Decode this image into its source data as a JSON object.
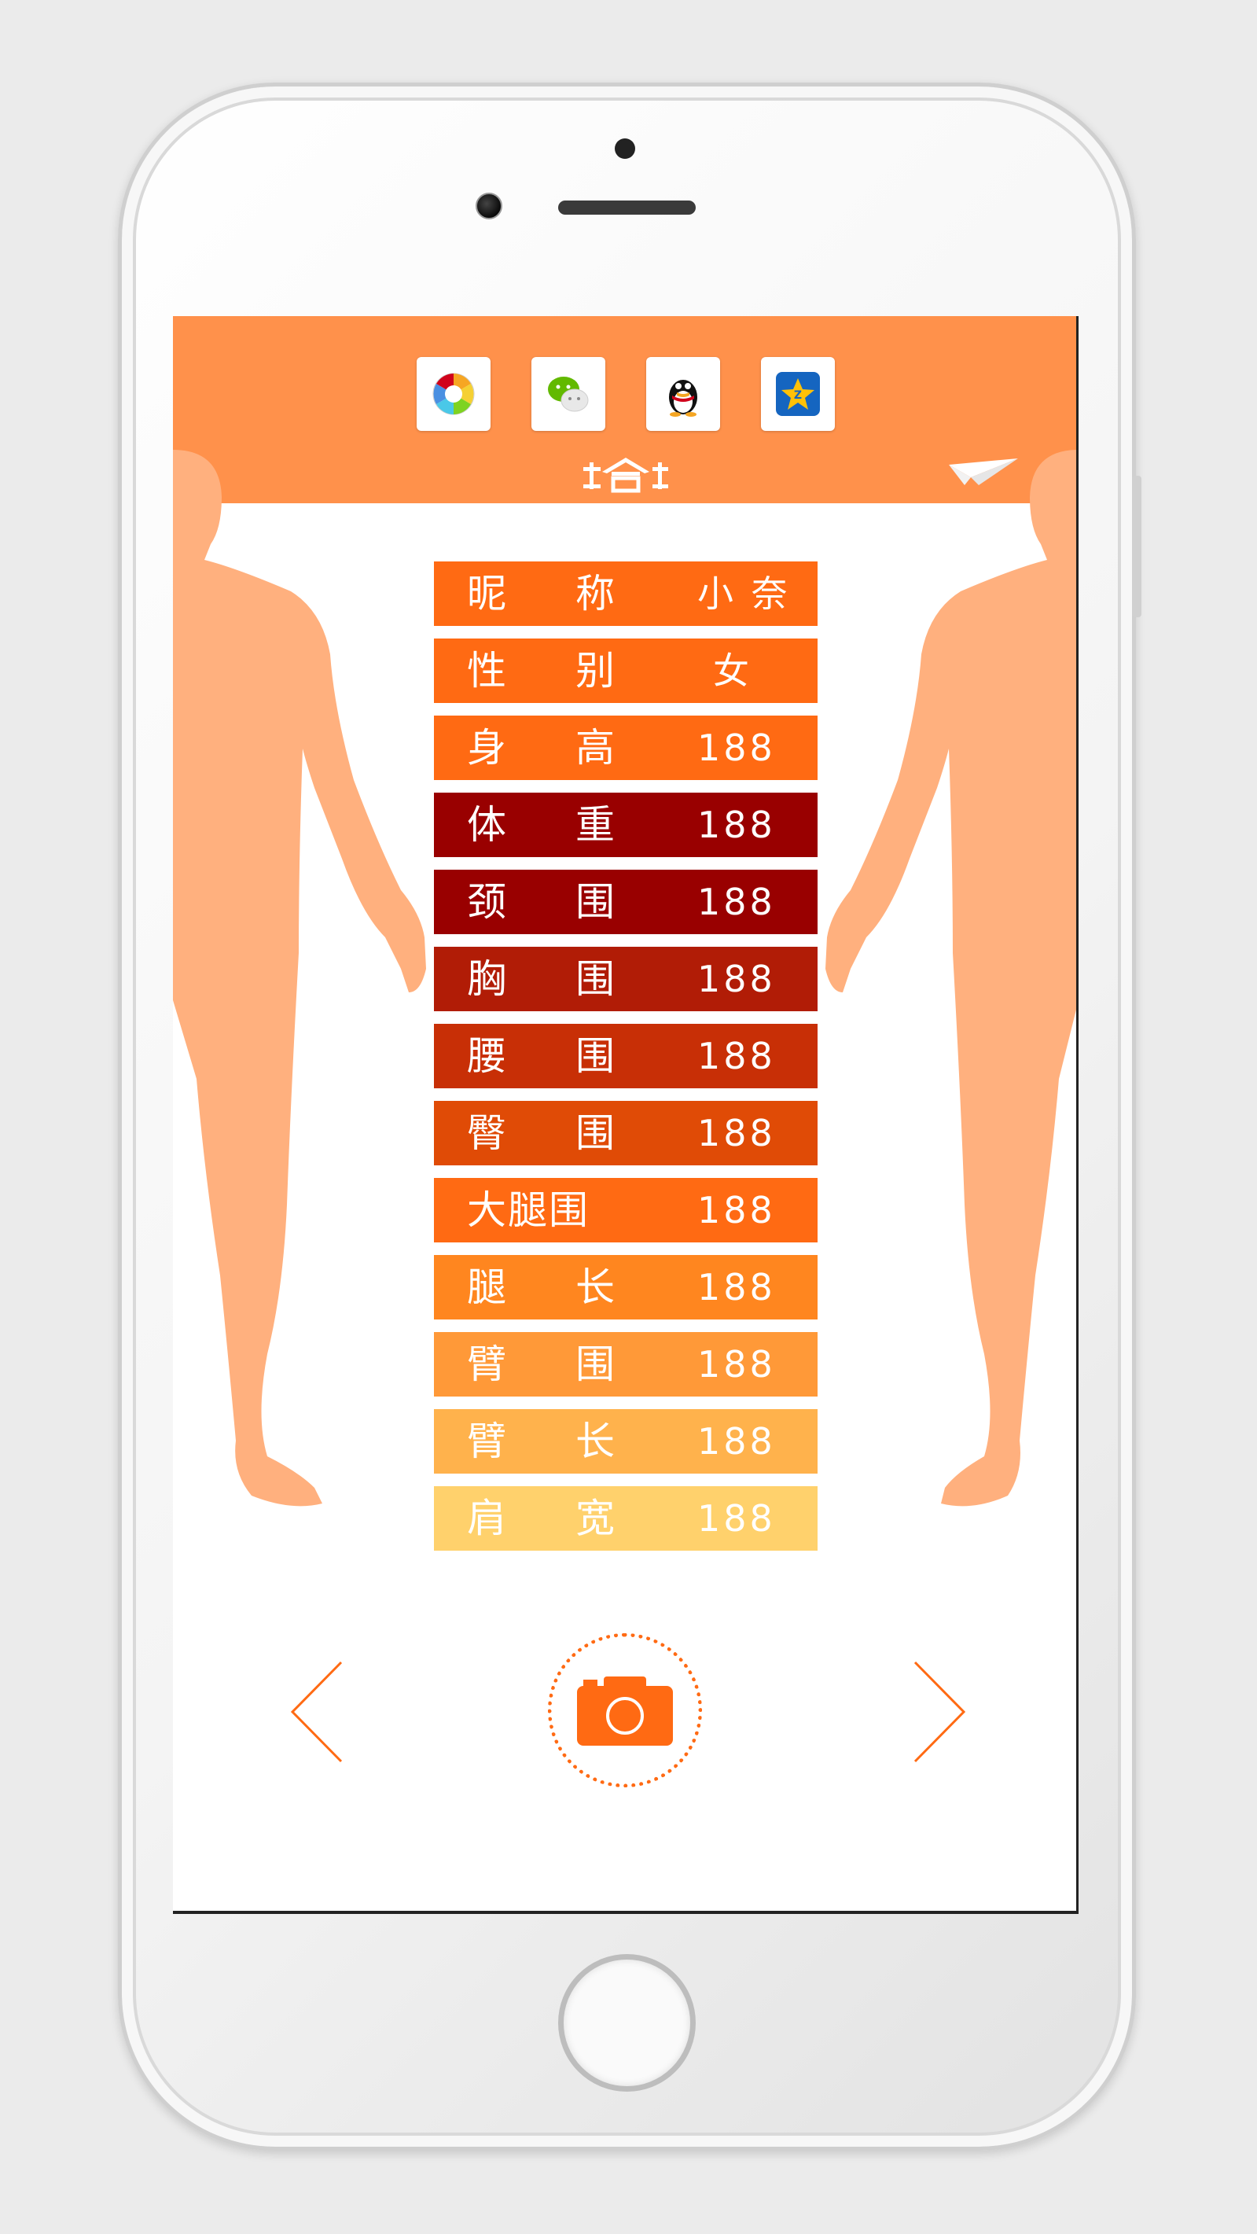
{
  "share_icons": [
    {
      "name": "photo-app-icon"
    },
    {
      "name": "wechat-icon"
    },
    {
      "name": "qq-icon"
    },
    {
      "name": "qzone-icon"
    }
  ],
  "colors": {
    "header": "#ff914b",
    "accent": "#ff6a13",
    "body_figure": "#ffb07e"
  },
  "measurements": [
    {
      "label1": "昵",
      "label2": "称",
      "value": "小 奈",
      "color": "#ff6a13"
    },
    {
      "label1": "性",
      "label2": "别",
      "value": "女",
      "color": "#ff6a13"
    },
    {
      "label1": "身",
      "label2": "高",
      "value": "188",
      "color": "#ff6a13"
    },
    {
      "label1": "体",
      "label2": "重",
      "value": "188",
      "color": "#990000"
    },
    {
      "label1": "颈",
      "label2": "围",
      "value": "188",
      "color": "#990000"
    },
    {
      "label1": "胸",
      "label2": "围",
      "value": "188",
      "color": "#b11c06"
    },
    {
      "label1": "腰",
      "label2": "围",
      "value": "188",
      "color": "#c82f06"
    },
    {
      "label1": "臀",
      "label2": "围",
      "value": "188",
      "color": "#e04b06"
    },
    {
      "label1": "大腿围",
      "label2": "",
      "value": "188",
      "color": "#ff6a13"
    },
    {
      "label1": "腿",
      "label2": "长",
      "value": "188",
      "color": "#ff861f"
    },
    {
      "label1": "臂",
      "label2": "围",
      "value": "188",
      "color": "#ff9938"
    },
    {
      "label1": "臂",
      "label2": "长",
      "value": "188",
      "color": "#ffb24c"
    },
    {
      "label1": "肩",
      "label2": "宽",
      "value": "188",
      "color": "#ffd16c"
    }
  ]
}
